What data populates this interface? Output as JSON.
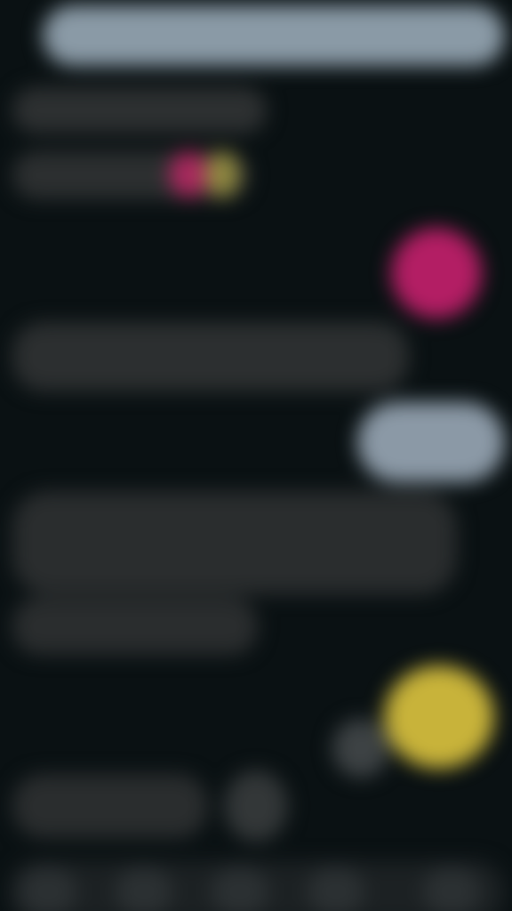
{
  "screen": {
    "background": "#0a1113",
    "accent_pink": "#b31e64",
    "accent_yellow": "#c8b33a",
    "bubble_light": "#8b99a6",
    "bubble_dark": "#2c2f30"
  },
  "icons": {
    "avatar_pink": "avatar-pink",
    "avatar_yellow": "avatar-yellow"
  }
}
